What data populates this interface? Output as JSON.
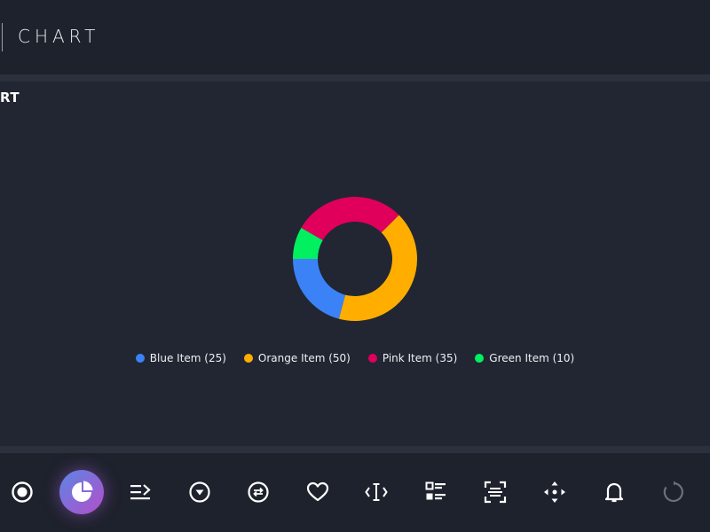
{
  "header": {
    "title": "CHART"
  },
  "panel": {
    "title": "RT"
  },
  "chart_data": {
    "type": "pie",
    "categories": [
      "Blue Item",
      "Orange Item",
      "Pink Item",
      "Green Item"
    ],
    "values": [
      25,
      50,
      35,
      10
    ],
    "colors": [
      "#3b82f6",
      "#ffae00",
      "#e0005c",
      "#00f060"
    ],
    "legend": [
      {
        "label": "Blue Item (25)",
        "color": "#3b82f6"
      },
      {
        "label": "Orange Item (50)",
        "color": "#ffae00"
      },
      {
        "label": "Pink Item (35)",
        "color": "#e0005c"
      },
      {
        "label": "Green Item (10)",
        "color": "#00f060"
      }
    ],
    "legend_position": "bottom",
    "donut": true
  },
  "toolbar": {
    "items": [
      {
        "icon": "radio-button-icon"
      },
      {
        "icon": "pie-chart-icon",
        "active": true
      },
      {
        "icon": "list-arrow-icon"
      },
      {
        "icon": "dropdown-circle-icon"
      },
      {
        "icon": "swap-circle-icon"
      },
      {
        "icon": "heart-icon"
      },
      {
        "icon": "text-cursor-icon"
      },
      {
        "icon": "list-checkbox-icon"
      },
      {
        "icon": "scan-text-icon"
      },
      {
        "icon": "move-arrows-icon"
      },
      {
        "icon": "bell-icon"
      },
      {
        "icon": "refresh-icon"
      }
    ]
  },
  "colors": {
    "background": "#1f2430",
    "header": "#1e222c",
    "accent_gradient_start": "#5b86e5",
    "accent_gradient_end": "#b44ec9"
  }
}
